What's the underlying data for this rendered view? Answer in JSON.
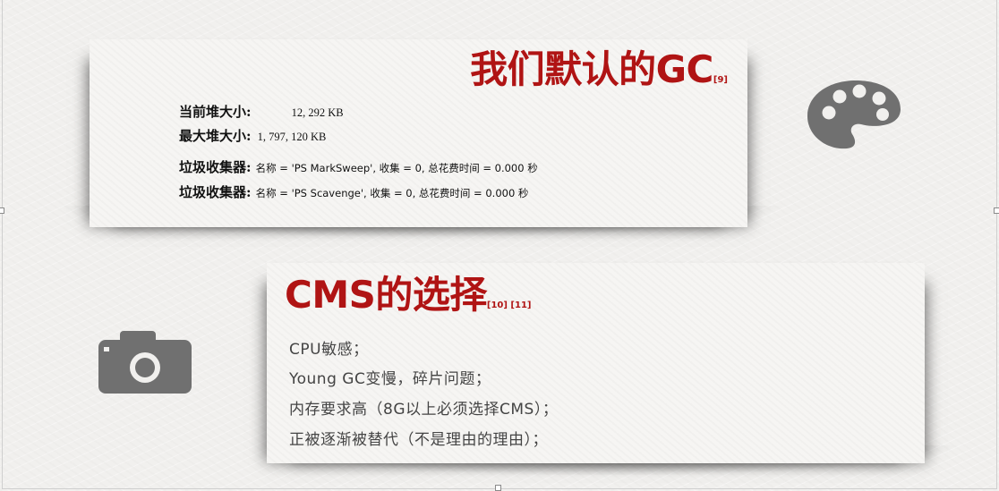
{
  "slide_top": {
    "title": "我们默认的GC",
    "ref": "[9]",
    "current_heap_label": "当前堆大小:",
    "current_heap_value": "12, 292 KB",
    "max_heap_label": "最大堆大小:",
    "max_heap_value": "1, 797, 120 KB",
    "collectors": [
      {
        "label": "垃圾收集器:",
        "value": "名称 = 'PS MarkSweep', 收集 = 0, 总花费时间 = 0.000 秒"
      },
      {
        "label": "垃圾收集器:",
        "value": "名称 = 'PS Scavenge', 收集 = 0, 总花费时间 = 0.000 秒"
      }
    ]
  },
  "slide_bottom": {
    "title": "CMS的选择",
    "refs": "[10] [11]",
    "bullets": [
      "CPU敏感；",
      "Young GC变慢，碎片问题；",
      "内存要求高（8G以上必须选择CMS）；",
      "正被逐渐被替代（不是理由的理由）；"
    ]
  },
  "icons": {
    "palette": "palette-icon",
    "camera": "camera-icon",
    "color": "#707070"
  },
  "colors": {
    "title_red": "#b01414",
    "background": "#f1f0ee"
  }
}
